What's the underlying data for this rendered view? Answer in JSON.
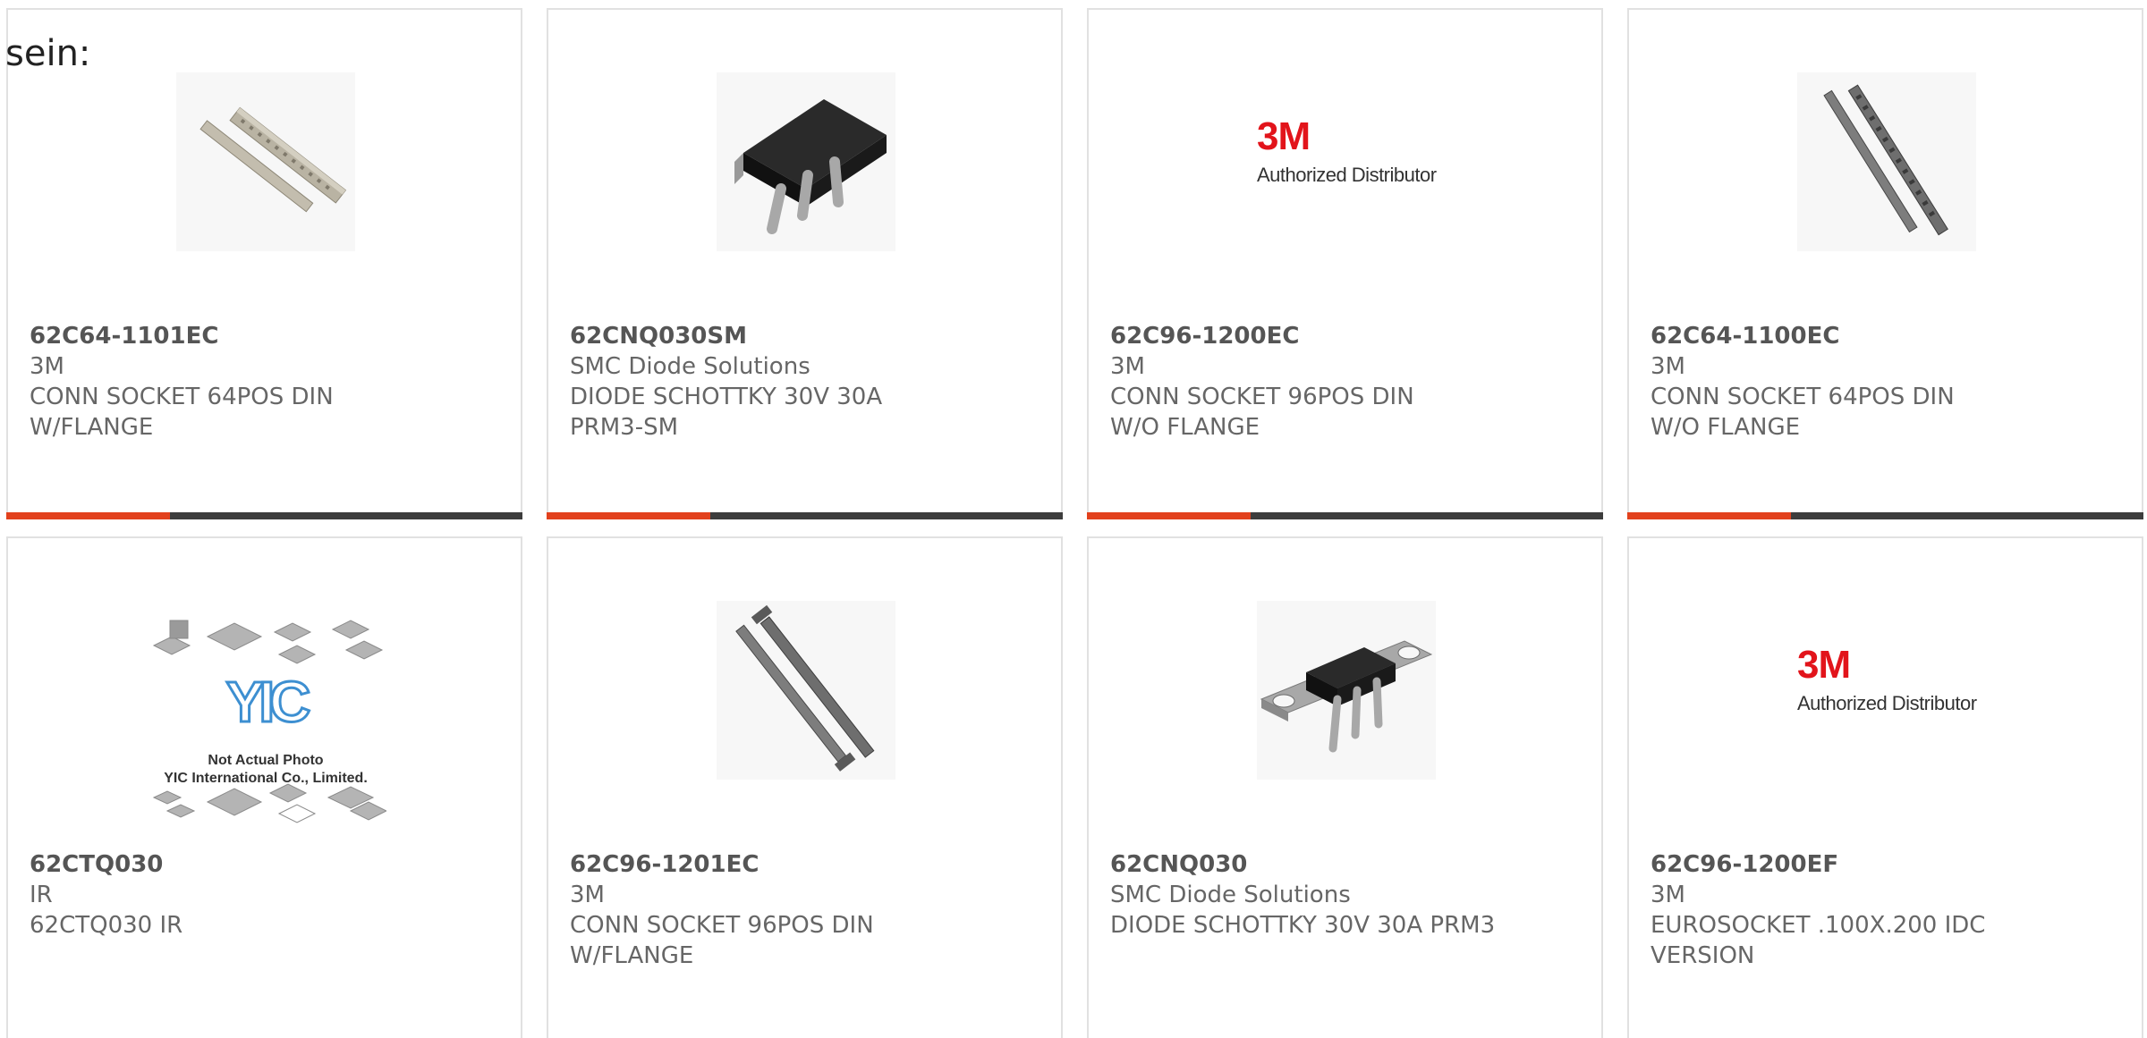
{
  "lead_text": "sein:",
  "products": [
    {
      "part_number": "62C64-1101EC",
      "manufacturer": "3M",
      "description": "CONN SOCKET 64POS DIN W/FLANGE",
      "image": "din-socket-pair-icon"
    },
    {
      "part_number": "62CNQ030SM",
      "manufacturer": "SMC Diode Solutions",
      "description": "DIODE SCHOTTKY 30V 30A PRM3-SM",
      "image": "schottky-diode-smd-icon"
    },
    {
      "part_number": "62C96-1200EC",
      "manufacturer": "3M",
      "description": "CONN SOCKET 96POS DIN W/O FLANGE",
      "image": "3m-authorized-distributor-logo"
    },
    {
      "part_number": "62C64-1100EC",
      "manufacturer": "3M",
      "description": "CONN SOCKET 64POS DIN W/O FLANGE",
      "image": "din-socket-strip-icon"
    },
    {
      "part_number": "62CTQ030",
      "manufacturer": "IR",
      "description": "62CTQ030 IR",
      "image": "yic-not-actual-photo-placeholder"
    },
    {
      "part_number": "62C96-1201EC",
      "manufacturer": "3M",
      "description": "CONN SOCKET 96POS DIN W/FLANGE",
      "image": "din-socket-strip-icon"
    },
    {
      "part_number": "62CNQ030",
      "manufacturer": "SMC Diode Solutions",
      "description": "DIODE SCHOTTKY 30V 30A PRM3",
      "image": "schottky-diode-flange-icon"
    },
    {
      "part_number": "62C96-1200EF",
      "manufacturer": "3M",
      "description": "EUROSOCKET .100X.200 IDC VERSION",
      "image": "3m-authorized-distributor-logo"
    }
  ],
  "logo": {
    "mark": "3M",
    "caption": "Authorized Distributor"
  },
  "placeholder": {
    "line1": "Not Actual Photo",
    "line2": "YIC International Co., Limited.",
    "brand": "YIC"
  },
  "colors": {
    "accent": "#e2411d",
    "bar": "#3d3d3d",
    "border": "#e1e1e1",
    "text": "#666666",
    "logo_red": "#e2141b"
  }
}
